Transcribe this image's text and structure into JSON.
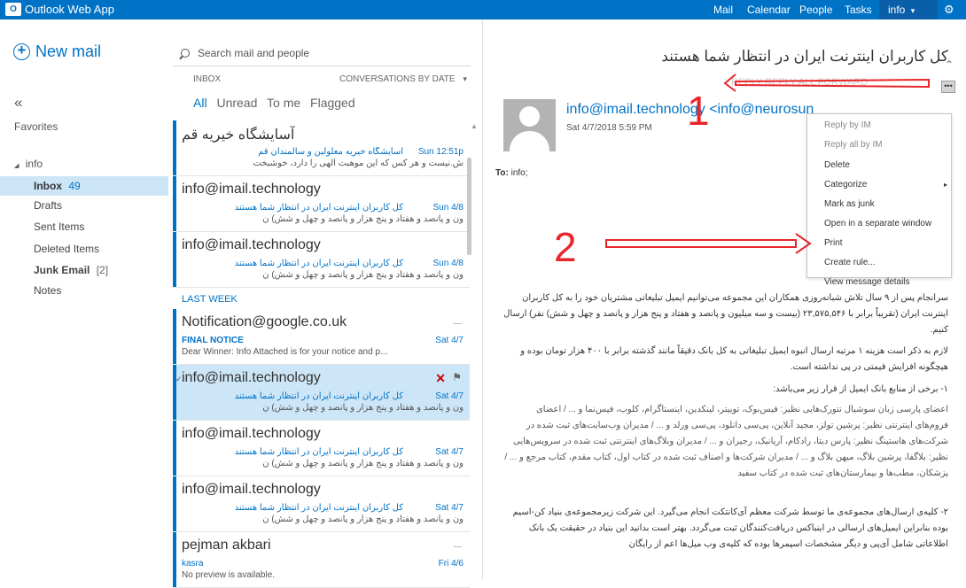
{
  "topbar": {
    "logo_text": "O",
    "app_title": "Outlook Web App",
    "nav": [
      "Mail",
      "Calendar",
      "People",
      "Tasks"
    ],
    "user": "info",
    "user_chevron": "▾",
    "gear": "⚙"
  },
  "leftnav": {
    "new_mail_plus": "+",
    "new_mail": "New mail",
    "collapse": "«",
    "favorites": "Favorites",
    "account_toggle": "◢",
    "account": "info",
    "folders": [
      {
        "name": "Inbox",
        "count": "49"
      },
      {
        "name": "Drafts",
        "count": ""
      },
      {
        "name": "Sent Items",
        "count": ""
      },
      {
        "name": "Deleted Items",
        "count": ""
      },
      {
        "name": "Junk Email",
        "count": "[2]"
      },
      {
        "name": "Notes",
        "count": ""
      }
    ]
  },
  "msglist": {
    "search_placeholder": "Search mail and people",
    "folder_label": "INBOX",
    "sort_label": "CONVERSATIONS BY DATE",
    "sort_chevron": "▾",
    "filters": [
      "All",
      "Unread",
      "To me",
      "Flagged"
    ],
    "last_week_label": "LAST WEEK",
    "scroll_up": "▲",
    "selected_check": "✓",
    "delete_icon": "✕",
    "flag_icon": "⚑",
    "attachment_icon": "🖇",
    "messages": [
      {
        "sender": "آسایشگاه خیریه قم",
        "subject": "آسایشگاه خیریه معلولین و سالمندان قم",
        "date": "Sun 12:51p",
        "preview": "ش.نیست و هر کس که این موهبت الهی را دارد، خوشبخت"
      },
      {
        "sender": "info@imail.technology",
        "subject": "کل کاربران اینترنت ایران در انتظار شما هستند",
        "date": "Sun 4/8",
        "preview": "ون و پانصد و هفتاد و پنج هزار و پانصد و چهل و شش) ن"
      },
      {
        "sender": "info@imail.technology",
        "subject": "کل کاربران اینترنت ایران در انتظار شما هستند",
        "date": "Sun 4/8",
        "preview": "ون و پانصد و هفتاد و پنج هزار و پانصد و چهل و شش) ن"
      },
      {
        "sender": "Notification@google.co.uk",
        "subject": "FINAL NOTICE",
        "date": "Sat 4/7",
        "preview": "Dear Winner: Info  Attached is for your notice and p..."
      },
      {
        "sender": "info@imail.technology",
        "subject": "کل کاربران اینترنت ایران در انتظار شما هستند",
        "date": "Sat 4/7",
        "preview": "ون و پانصد و هفتاد و پنج هزار و پانصد و چهل و شش) ن"
      },
      {
        "sender": "info@imail.technology",
        "subject": "کل کاربران اینترنت ایران در انتظار شما هستند",
        "date": "Sat 4/7",
        "preview": "ون و پانصد و هفتاد و پنج هزار و پانصد و چهل و شش) ن"
      },
      {
        "sender": "info@imail.technology",
        "subject": "کل کاربران اینترنت ایران در انتظار شما هستند",
        "date": "Sat 4/7",
        "preview": "ون و پانصد و هفتاد و پنج هزار و پانصد و چهل و شش) ن"
      },
      {
        "sender": "pejman akbari",
        "subject": "kasra",
        "date": "Fri 4/6",
        "preview": "No preview is available."
      }
    ]
  },
  "reading": {
    "subject": "کل کاربران اینترنت ایران در انتظار شما هستند",
    "collapse_chevron": "⌃",
    "from": "info@imail.technology <info@neurosun",
    "datetime": "Sat 4/7/2018 5:59 PM",
    "to_label": "To:",
    "to_value": "info;",
    "hidden_actions": "REPLY    REPLY ALL    FORWARD",
    "ellipsis": "•••",
    "paragraphs": [
      "سرانجام پس از ۹ سال تلاش شبانه‌روزی همکاران این مجموعه می‌توانیم ایمیل تبلیغاتی مشتریان خود را به کل کاربران اینترنت ایران (تقریباً برابر با ۲۳,۵۷۵,۵۴۶ (بیست و سه میلیون و پانصد و هفتاد و پنج هزار و پانصد و چهل و شش) نفر) ارسال کنیم.",
      "لازم به ذکر است هزینه ۱ مرتبه ارسال انبوه ایمیل تبلیغاتی به کل بانک دقیقاً مانند گذشته برابر با ۴۰۰ هزار تومان بوده و هیچگونه افزایش قیمتی در پی نداشته است.",
      "۱- برخی از منابع بانک ایمیل از قرار زیر می‌باشد:",
      "اعضای پارسی زبان سوشیال نتورک‌هایی نظیر: فیس‌بوک، توییتر، لینکدین، اینستاگرام، کلوب، فیس‌نما و ... / اعضای فروم‌های اینترنتی نظیر: پرشین تولز، مجید آنلاین، پی‌سی دانلود، پی‌سی ورلد و ... / مدیران وب‌سایت‌های ثبت شده در شرکت‌های هاستینگ نظیر: پارس دیتا، رادکام، آریانیک، رجیران و ... / مدیران وبلاگ‌های اینترنتی ثبت شده در سرویس‌هایی نظیر: بلاگفا، پرشین بلاگ، میهن بلاگ و ... / مدیران شرکت‌ها و اصناف ثبت شده در کتاب اول، کتاب مقدم، کتاب مرجع و ... / پزشکان، مطب‌ها و بیمارستان‌های ثبت شده در کتاب سفید",
      "۲- کلیه‌ی ارسال‌های مجموعه‌ی ما توسط شرکت معظم آی‌کانتکت انجام می‌گیرد. این شرکت زیرمجموعه‌ی بنیاد کن-اسیم بوده بنابراین ایمیل‌های ارسالی در اینباکس دریافت‌کنندگان ثبت می‌گردد. بهتر است بدانید این بنیاد در حقیقت یک بانک اطلاعاتی شامل آی‌پی و دیگر مشخصات اسپمرها بوده که کلیه‌ی وب میل‌ها اعم از رایگان"
    ]
  },
  "context_menu": {
    "items": [
      {
        "label": "Reply by IM",
        "disabled": true
      },
      {
        "label": "Reply all by IM",
        "disabled": true
      },
      {
        "label": "Delete",
        "disabled": false
      },
      {
        "label": "Categorize",
        "disabled": false
      },
      {
        "label": "Mark as junk",
        "disabled": false
      },
      {
        "label": "Open in a separate window",
        "disabled": false
      },
      {
        "label": "Print",
        "disabled": false
      },
      {
        "label": "Create rule...",
        "disabled": false
      },
      {
        "label": "View message details",
        "disabled": false
      }
    ],
    "submenu_arrow": "▸"
  },
  "annotations": {
    "marker_1": "1",
    "marker_2": "2",
    "color": "#e8262a"
  },
  "colors": {
    "accent": "#0072c6",
    "selection": "#cde6f7"
  }
}
